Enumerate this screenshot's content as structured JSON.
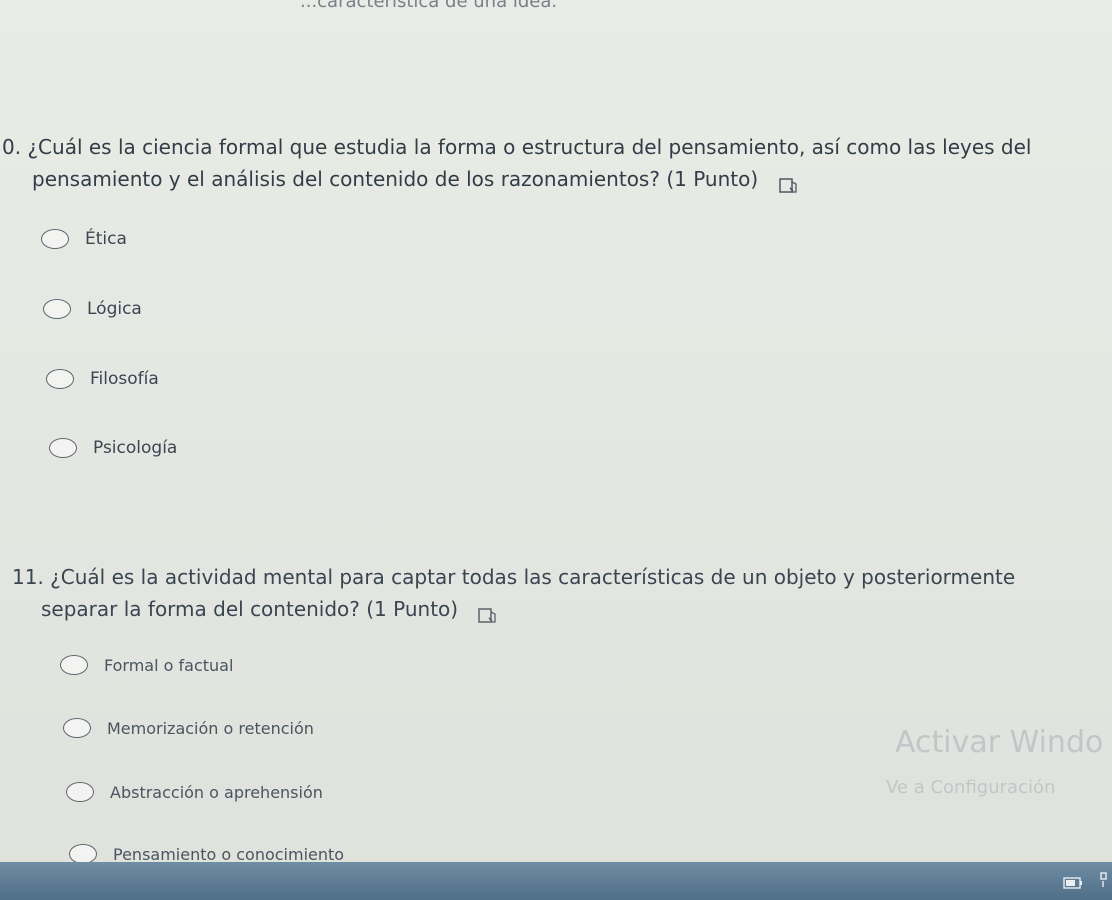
{
  "top_partial_text": "...característica de una idea.",
  "questions": [
    {
      "line1": "0. ¿Cuál es la ciencia formal que estudia la forma o estructura del pensamiento, así como las leyes del",
      "line2": "pensamiento y el análisis del contenido de los razonamientos? (1 Punto)",
      "options": [
        "Ética",
        "Lógica",
        "Filosofía",
        "Psicología"
      ]
    },
    {
      "line1": "11. ¿Cuál es la actividad mental para captar todas las características de un objeto y posteriormente",
      "line2": "separar la forma del contenido? (1 Punto)",
      "options": [
        "Formal o factual",
        "Memorización o retención",
        "Abstracción o aprehensión",
        "Pensamiento o conocimiento"
      ]
    }
  ],
  "watermark": {
    "title": "Activar Windo",
    "subtitle": "Ve a Configuración"
  },
  "icons": {
    "read_aloud": "immersive-reader-icon",
    "tray": [
      "battery-icon",
      "tray-overflow-icon"
    ]
  },
  "colors": {
    "background": "#e6e8e3",
    "text": "#323d47",
    "radio_border": "#5c6670",
    "taskbar": "#5a7891"
  }
}
